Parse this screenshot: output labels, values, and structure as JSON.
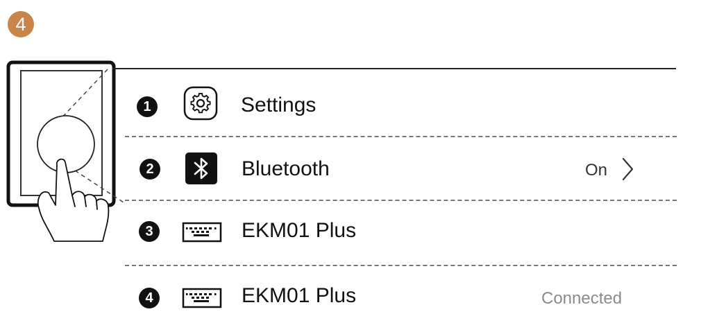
{
  "step": {
    "number": "4",
    "color": "#c9844a"
  },
  "rows": [
    {
      "number": "1",
      "icon": "settings-gear-icon",
      "label": "Settings",
      "status": ""
    },
    {
      "number": "2",
      "icon": "bluetooth-icon",
      "label": "Bluetooth",
      "status": "On"
    },
    {
      "number": "3",
      "icon": "keyboard-icon",
      "label": "EKM01 Plus",
      "status": ""
    },
    {
      "number": "4",
      "icon": "keyboard-icon",
      "label": "EKM01 Plus",
      "status": "Connected"
    }
  ]
}
